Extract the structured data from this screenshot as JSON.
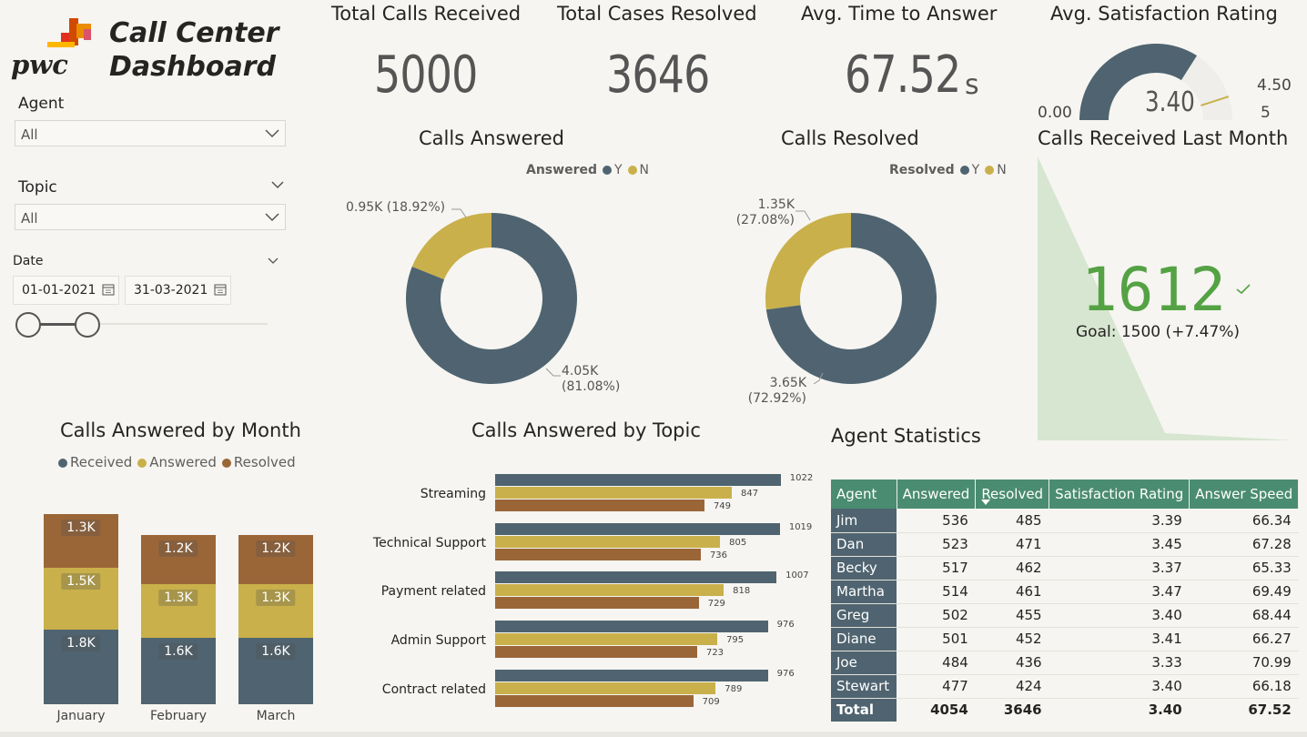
{
  "brand": {
    "logo_text": "pwc",
    "title_line1": "Call Center",
    "title_line2": "Dashboard"
  },
  "filters": {
    "agent_label": "Agent",
    "agent_value": "All",
    "topic_label": "Topic",
    "topic_value": "All",
    "date_label": "Date",
    "date_start": "01-01-2021",
    "date_end": "31-03-2021",
    "date_range_fraction": [
      0,
      1
    ]
  },
  "kpis": {
    "total_calls_title": "Total Calls Received",
    "total_calls_value": "5000",
    "cases_resolved_title": "Total Cases Resolved",
    "cases_resolved_value": "3646",
    "avg_time_title": "Avg. Time to Answer",
    "avg_time_value": "67.52",
    "avg_time_unit": "s",
    "satisfaction_title": "Avg. Satisfaction Rating",
    "satisfaction_value": "3.40",
    "satisfaction_min": "0.00",
    "satisfaction_max": "5",
    "satisfaction_target": "4.50"
  },
  "calls_answered_donut": {
    "title": "Calls Answered",
    "legend_title": "Answered",
    "legend_y": "Y",
    "legend_n": "N",
    "y_label_1": "4.05K",
    "y_label_2": "(81.08%)",
    "n_label": "0.95K (18.92%)"
  },
  "calls_resolved_donut": {
    "title": "Calls Resolved",
    "legend_title": "Resolved",
    "legend_y": "Y",
    "legend_n": "N",
    "y_label_1": "3.65K",
    "y_label_2": "(72.92%)",
    "n_label_1": "1.35K",
    "n_label_2": "(27.08%)"
  },
  "last_month": {
    "title": "Calls Received Last Month",
    "value": "1612",
    "goal_label": "Goal:",
    "goal_value": "1500",
    "goal_delta": "(+7.47%)"
  },
  "by_month": {
    "title": "Calls Answered by Month",
    "legend": [
      "Received",
      "Answered",
      "Resolved"
    ],
    "months": [
      "January",
      "February",
      "March"
    ],
    "labels_received": [
      "1.8K",
      "1.6K",
      "1.6K"
    ],
    "labels_answered": [
      "1.5K",
      "1.3K",
      "1.3K"
    ],
    "labels_resolved": [
      "1.3K",
      "1.2K",
      "1.2K"
    ]
  },
  "by_topic": {
    "title": "Calls Answered by Topic",
    "topics": [
      "Streaming",
      "Technical Support",
      "Payment related",
      "Admin Support",
      "Contract related"
    ]
  },
  "agent_stats": {
    "title": "Agent Statistics",
    "headers": [
      "Agent",
      "Answered",
      "Resolved",
      "Satisfaction Rating",
      "Answer Speed"
    ],
    "rows": [
      [
        "Jim",
        "536",
        "485",
        "3.39",
        "66.34"
      ],
      [
        "Dan",
        "523",
        "471",
        "3.45",
        "67.28"
      ],
      [
        "Becky",
        "517",
        "462",
        "3.37",
        "65.33"
      ],
      [
        "Martha",
        "514",
        "461",
        "3.47",
        "69.49"
      ],
      [
        "Greg",
        "502",
        "455",
        "3.40",
        "68.44"
      ],
      [
        "Diane",
        "501",
        "452",
        "3.41",
        "66.27"
      ],
      [
        "Joe",
        "484",
        "436",
        "3.33",
        "70.99"
      ],
      [
        "Stewart",
        "477",
        "424",
        "3.40",
        "66.18"
      ]
    ],
    "total": [
      "Total",
      "4054",
      "3646",
      "3.40",
      "67.52"
    ]
  },
  "colors": {
    "received": "#4f6470",
    "answered": "#c9b04a",
    "resolved": "#9a6638",
    "table_header": "#4a8c71",
    "good": "#54a244"
  },
  "chart_data": [
    {
      "type": "pie",
      "title": "Calls Answered",
      "categories": [
        "Y",
        "N"
      ],
      "values": [
        4054,
        946
      ],
      "percent": [
        81.08,
        18.92
      ]
    },
    {
      "type": "pie",
      "title": "Calls Resolved",
      "categories": [
        "Y",
        "N"
      ],
      "values": [
        3646,
        1354
      ],
      "percent": [
        72.92,
        27.08
      ]
    },
    {
      "type": "bar",
      "title": "Calls Answered by Month",
      "categories": [
        "January",
        "February",
        "March"
      ],
      "series": [
        {
          "name": "Received",
          "values": [
            1800,
            1600,
            1600
          ]
        },
        {
          "name": "Answered",
          "values": [
            1500,
            1300,
            1300
          ]
        },
        {
          "name": "Resolved",
          "values": [
            1300,
            1200,
            1200
          ]
        }
      ]
    },
    {
      "type": "bar",
      "title": "Calls Answered by Topic",
      "categories": [
        "Streaming",
        "Technical Support",
        "Payment related",
        "Admin Support",
        "Contract related"
      ],
      "series": [
        {
          "name": "Received",
          "values": [
            1022,
            1019,
            1007,
            976,
            976
          ]
        },
        {
          "name": "Answered",
          "values": [
            847,
            805,
            818,
            795,
            789
          ]
        },
        {
          "name": "Resolved",
          "values": [
            749,
            736,
            729,
            723,
            709
          ]
        }
      ]
    }
  ]
}
